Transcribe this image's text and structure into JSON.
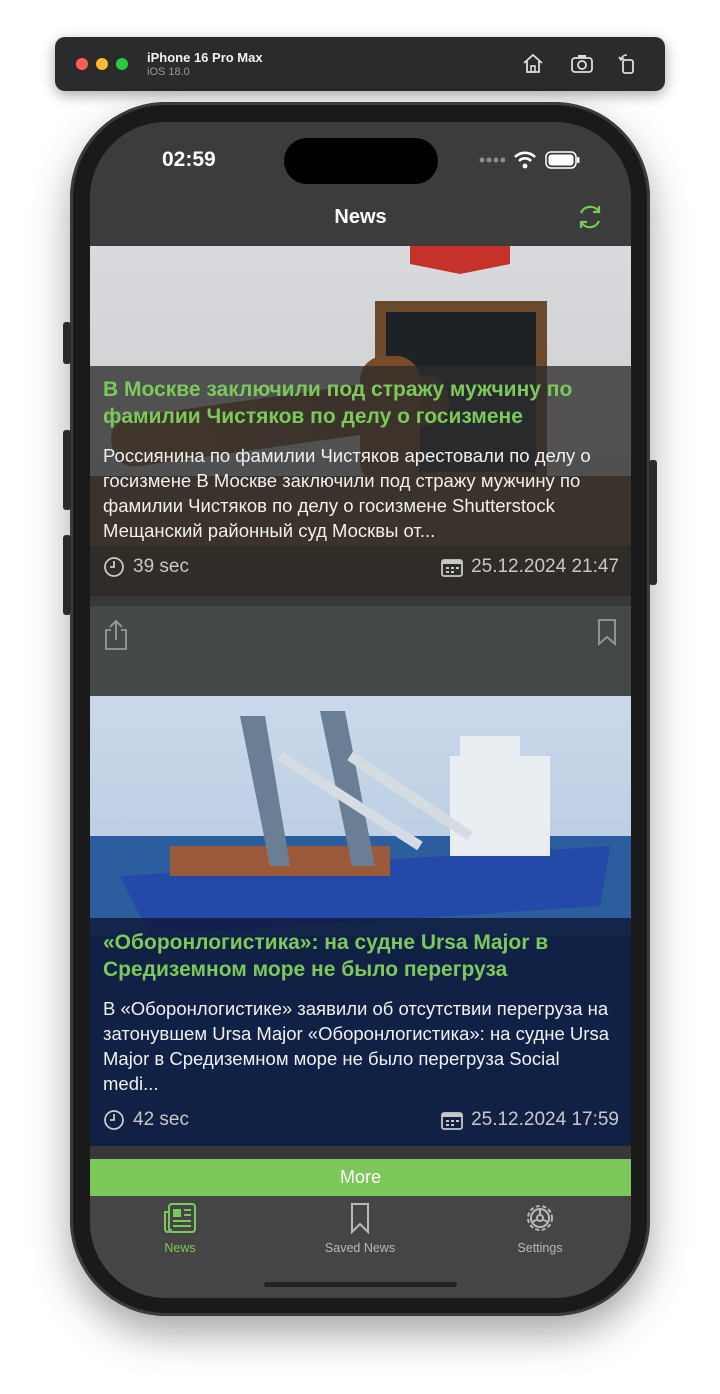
{
  "simulator": {
    "device_name": "iPhone 16 Pro Max",
    "os_version": "iOS 18.0",
    "icons": [
      "home-icon",
      "screenshot-icon",
      "rotate-icon"
    ]
  },
  "status_bar": {
    "time": "02:59"
  },
  "nav": {
    "title": "News",
    "refresh_icon": "refresh-icon"
  },
  "articles": [
    {
      "title": "В Москве заключили под стражу мужчину по фамилии Чистяков по делу о госизмене",
      "description": "Россиянина по фамилии Чистяков арестовали по делу о госизмене В Москве заключили под стражу мужчину по фамилии Чистяков по делу о госизмене Shutterstock Мещанский районный суд Москвы от...",
      "elapsed": "39 sec",
      "date": "25.12.2024 21:47"
    },
    {
      "title": "«Оборонлогистика»: на судне Ursa Major в Средиземном море не было перегруза",
      "description": "В «Оборонлогистике» заявили об отсутствии перегруза на затонувшем Ursa Major «Оборонлогистика»: на судне Ursa Major в Средиземном море не было перегруза Social medi...",
      "elapsed": "42 sec",
      "date": "25.12.2024 17:59"
    }
  ],
  "more_button": {
    "label": "More"
  },
  "tabs": [
    {
      "label": "News",
      "icon": "newspaper-icon",
      "active": true
    },
    {
      "label": "Saved News",
      "icon": "bookmark-icon",
      "active": false
    },
    {
      "label": "Settings",
      "icon": "gear-icon",
      "active": false
    }
  ],
  "colors": {
    "accent": "#7cc85a",
    "background": "#383838",
    "tabbar": "#454545"
  }
}
